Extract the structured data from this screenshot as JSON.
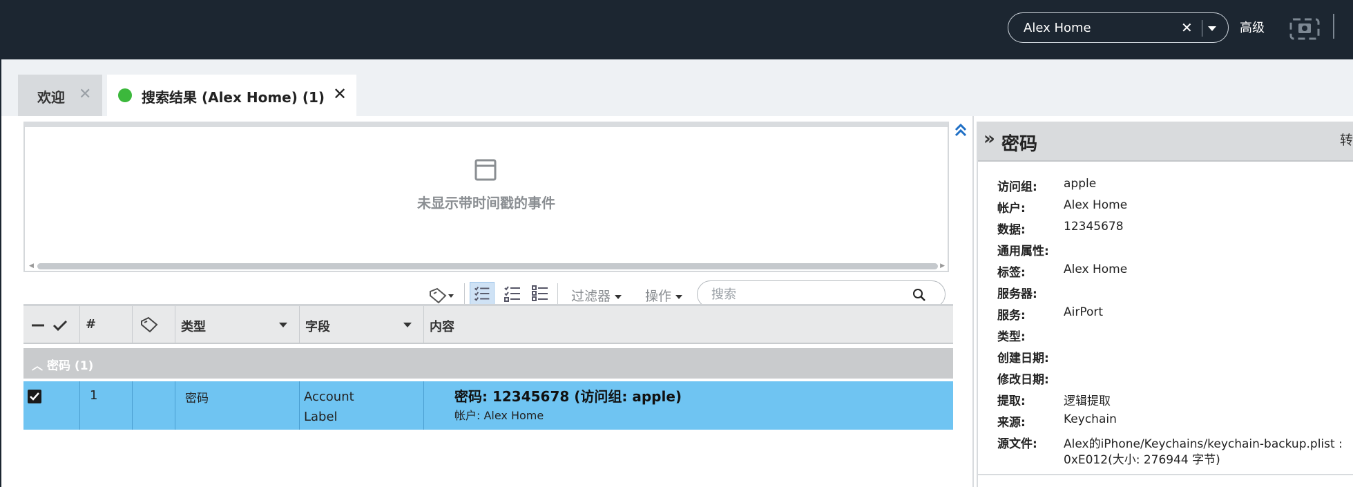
{
  "topbar": {
    "search_value": "Alex Home",
    "clear_glyph": "✕",
    "advanced_label": "高级",
    "camera_icon": "camera-icon"
  },
  "tabs": [
    {
      "label": "欢迎",
      "close": "✕"
    },
    {
      "label": "搜索结果 (Alex Home) (1)",
      "close": "✕",
      "status_color": "#3cb83c"
    }
  ],
  "timeline": {
    "empty_text": "未显示带时间戳的事件"
  },
  "toolbar": {
    "filter_label": "过滤器",
    "action_label": "操作",
    "search_placeholder": "搜索"
  },
  "grid": {
    "columns": [
      "",
      "#",
      "",
      "类型",
      "字段",
      "内容"
    ],
    "group": {
      "label": "密码  (1)"
    },
    "rows": [
      {
        "checked": true,
        "number": "1",
        "type": "密码",
        "field_line1": "Account",
        "field_line2": "Label",
        "content_title": "密码: 12345678 (访问组: apple)",
        "content_sub": "帐户: Alex Home"
      }
    ],
    "selected_row_color": "#6fc4f2"
  },
  "details": {
    "title": "密码",
    "cut_label": "转",
    "properties": [
      {
        "key": "访问组:",
        "value": "apple"
      },
      {
        "key": "帐户:",
        "value": "Alex Home"
      },
      {
        "key": "数据:",
        "value": "12345678"
      },
      {
        "key": "通用属性:",
        "value": ""
      },
      {
        "key": "标签:",
        "value": "Alex Home"
      },
      {
        "key": "服务器:",
        "value": ""
      },
      {
        "key": "服务:",
        "value": "AirPort"
      },
      {
        "key": "类型:",
        "value": ""
      },
      {
        "key": "创建日期:",
        "value": ""
      },
      {
        "key": "修改日期:",
        "value": ""
      },
      {
        "key": "提取:",
        "value": "逻辑提取"
      },
      {
        "key": "来源:",
        "value": "Keychain"
      },
      {
        "key": "源文件:",
        "value": "Alex的iPhone/Keychains/keychain-backup.plist :",
        "value2": "0xE012(大小: 276944 字节)"
      }
    ]
  }
}
